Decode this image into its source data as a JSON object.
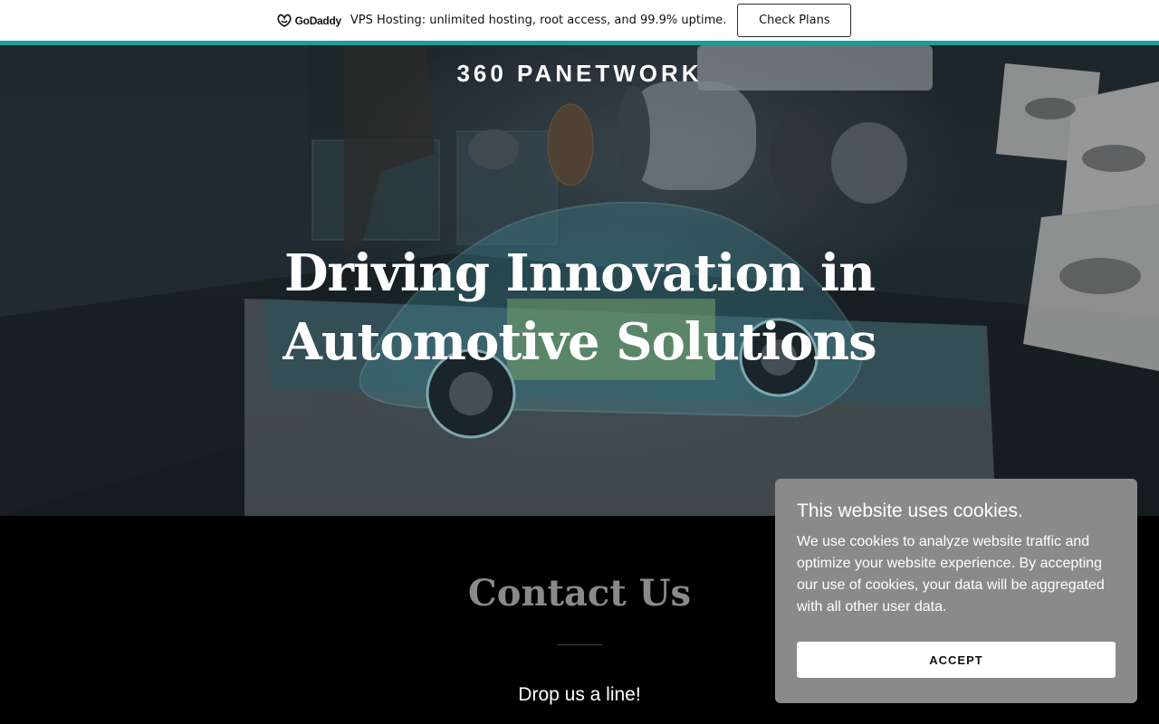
{
  "promo": {
    "logo_text": "GoDaddy",
    "message": "VPS Hosting: unlimited hosting, root access, and 99.9% uptime.",
    "cta_label": "Check Plans",
    "accent_color": "#1a9e9a"
  },
  "hero": {
    "brand": "360 PANETWORK",
    "title_line1": "Driving Innovation in",
    "title_line2": "Automotive Solutions",
    "background_image": "holographic-car-chassis-display"
  },
  "contact": {
    "title": "Contact Us",
    "subtitle": "Drop us a line!"
  },
  "cookie_banner": {
    "title": "This website uses cookies.",
    "body": "We use cookies to analyze website traffic and optimize your website experience. By accepting our use of cookies, your data will be aggregated with all other user data.",
    "accept_label": "ACCEPT",
    "background_color": "#8a8a8a"
  }
}
